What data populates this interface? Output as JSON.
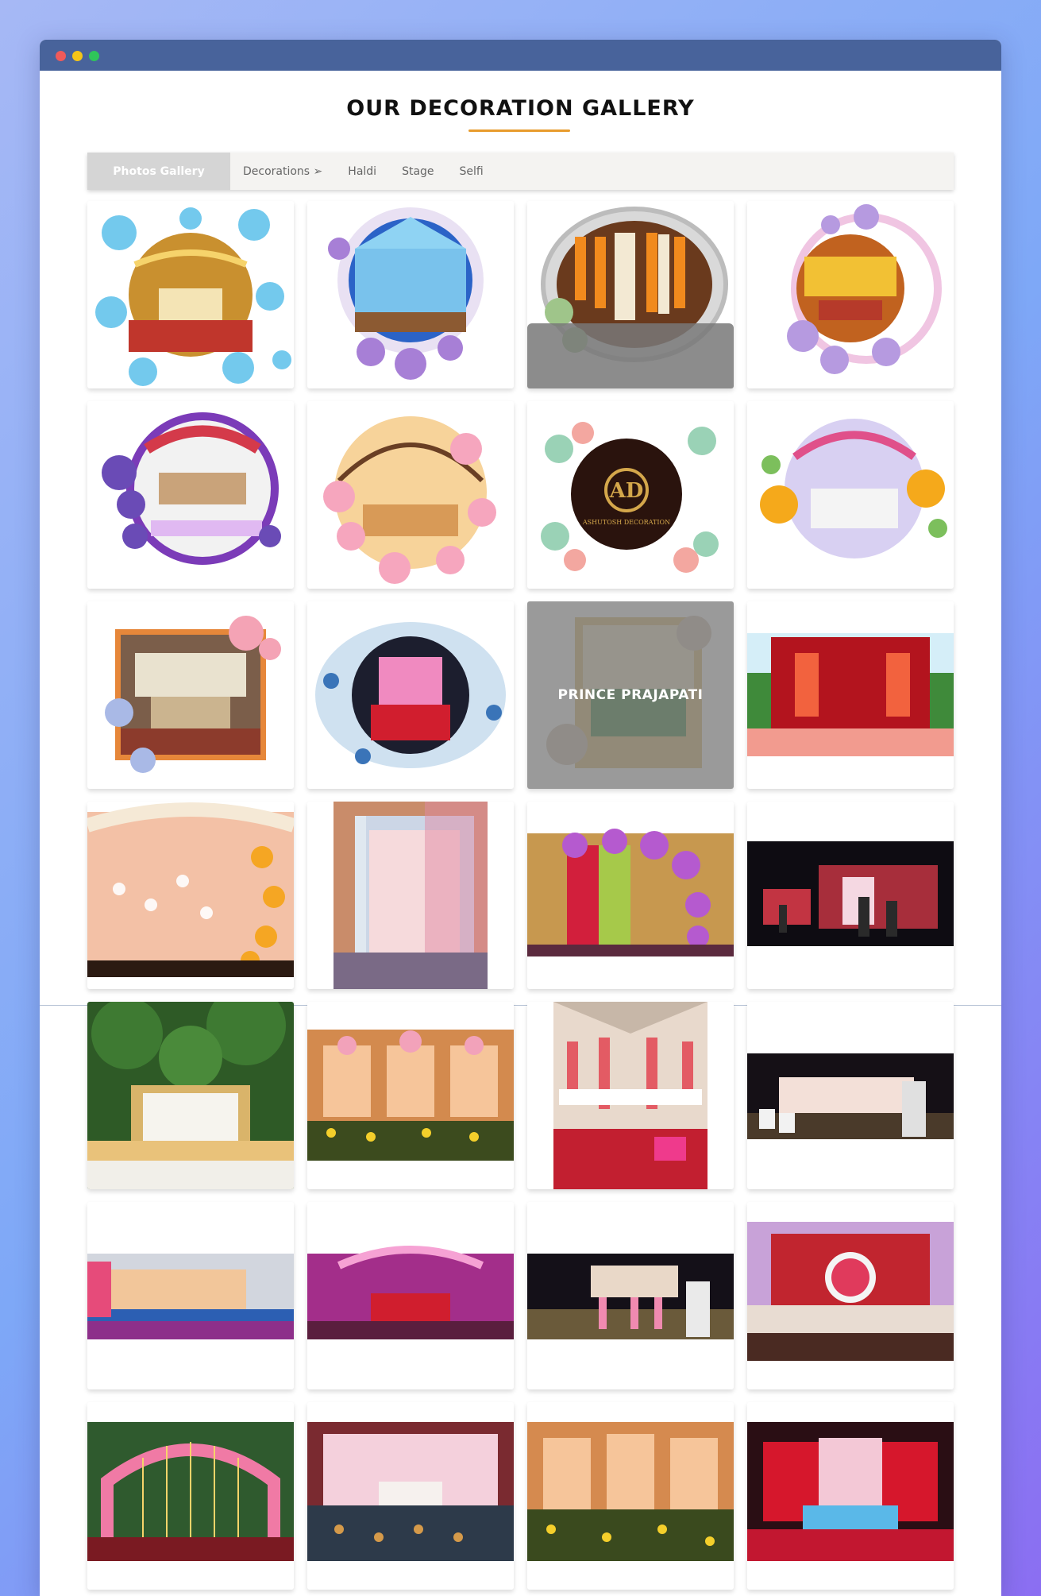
{
  "page": {
    "heading": "OUR DECORATION GALLERY",
    "accent_color": "#e89b2c"
  },
  "filters": [
    {
      "label": "Photos Gallery",
      "active": true
    },
    {
      "label": "Decorations ➢",
      "active": false
    },
    {
      "label": "Haldi",
      "active": false
    },
    {
      "label": "Stage",
      "active": false
    },
    {
      "label": "Selfi",
      "active": false
    }
  ],
  "gallery": {
    "hover_caption": "PRINCE PRAJAPATI",
    "logo_text": "AD",
    "logo_subtext": "ASHUTOSH DECORATION"
  }
}
